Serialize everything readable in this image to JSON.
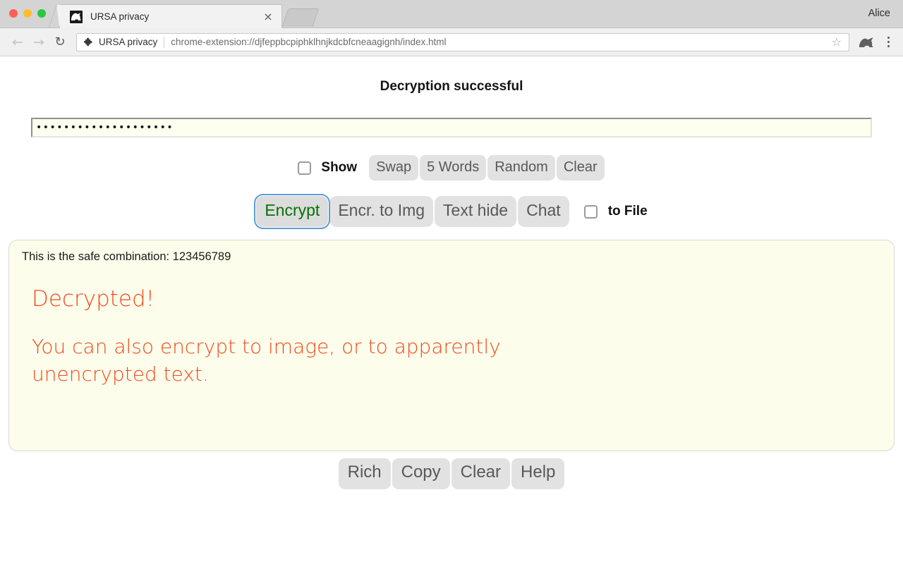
{
  "browser": {
    "profile_name": "Alice",
    "tab": {
      "title": "URSA privacy",
      "close_label": "×",
      "favicon_name": "ursa-bear-favicon"
    },
    "toolbar": {
      "back_glyph": "←",
      "forward_glyph": "→",
      "reload_glyph": "↻",
      "site_label": "URSA privacy",
      "url": "chrome-extension://djfeppbcpiphklhnjkdcbfcneaagignh/index.html",
      "star_glyph": "☆"
    }
  },
  "app": {
    "status_title": "Decryption successful",
    "password": {
      "value": "••••••••••••••••••••",
      "placeholder": "Password"
    },
    "options_row": {
      "show_label": "Show",
      "show_checked": false,
      "buttons": [
        {
          "label": "Swap"
        },
        {
          "label": "5 Words"
        },
        {
          "label": "Random"
        },
        {
          "label": "Clear"
        }
      ]
    },
    "mode_row": {
      "tabs": [
        {
          "label": "Encrypt",
          "active": true
        },
        {
          "label": "Encr. to Img",
          "active": false
        },
        {
          "label": "Text hide",
          "active": false
        },
        {
          "label": "Chat",
          "active": false
        }
      ],
      "to_file_label": "to File",
      "to_file_checked": false
    },
    "content": {
      "line_plain": "This is the safe combination: 123456789",
      "line_heading": "Decrypted!",
      "line_paragraph": "You can also encrypt to image, or to apparently unencrypted text."
    },
    "actions": [
      {
        "label": "Rich"
      },
      {
        "label": "Copy"
      },
      {
        "label": "Clear"
      },
      {
        "label": "Help"
      }
    ],
    "colors": {
      "accent_orange": "#f04a18",
      "active_tab_text": "#067106",
      "focus_ring": "#5b9dd9",
      "content_bg": "#fdfdec",
      "input_bg": "#fffff0"
    }
  }
}
